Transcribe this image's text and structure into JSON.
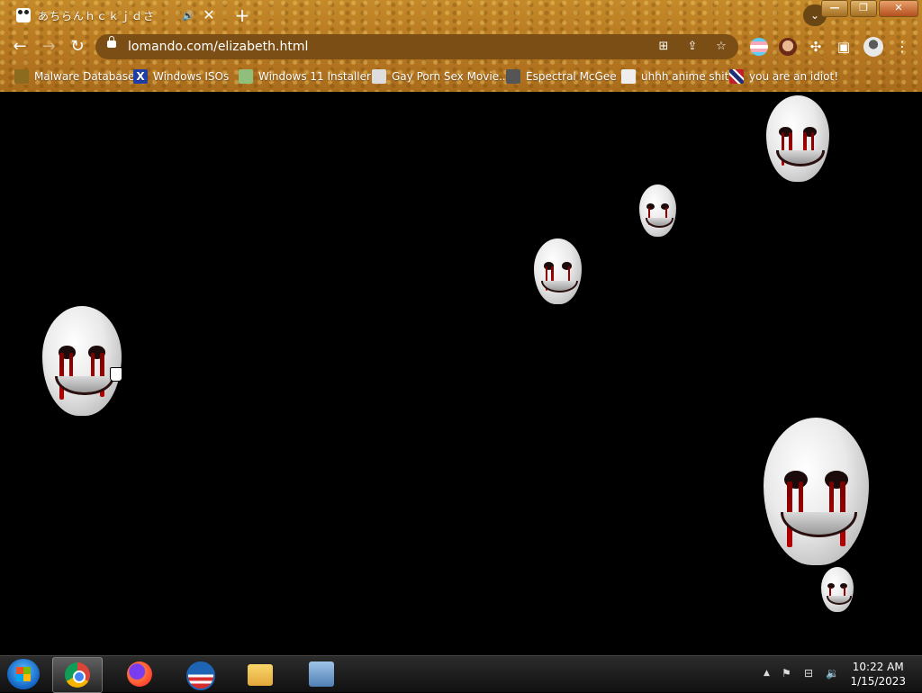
{
  "tab": {
    "title": "あちらんｈｃｋｊｄさ",
    "audio_icon": "speaker-icon",
    "close_label": "✕"
  },
  "window_controls": {
    "minimize": "—",
    "restore": "❐",
    "close": "✕"
  },
  "toolbar": {
    "back": "←",
    "forward": "→",
    "reload": "↻",
    "url": "lomando.com/elizabeth.html"
  },
  "omnibox_icons": [
    "translate-icon",
    "share-icon",
    "bookmark-star-icon"
  ],
  "extensions": [
    "trans-flag-extension-icon",
    "face-extension-icon",
    "puzzle-extension-icon",
    "side-panel-icon",
    "profile-avatar-icon",
    "menu-kebab-icon"
  ],
  "bookmarks": [
    {
      "label": "Malware Database",
      "icon": "folder-icon",
      "color": "#8c6a1e"
    },
    {
      "label": "Windows ISOs",
      "icon": "x-icon",
      "color": "#1f3ea8"
    },
    {
      "label": "Windows 11 Installer",
      "icon": "installer-icon",
      "color": "#8fbf7a"
    },
    {
      "label": "Gay Porn Sex Movie...",
      "icon": "site-icon",
      "color": "#dddddd"
    },
    {
      "label": "Espectral McGee",
      "icon": "cat-icon",
      "color": "#555555"
    },
    {
      "label": "uhhh anime shit",
      "icon": "anime-icon",
      "color": "#eeeeee"
    },
    {
      "label": "you are an idiot!",
      "icon": "flag-icon",
      "color": "#c21e2b"
    }
  ],
  "page": {
    "background": "#000000",
    "content": "floating white masks with bleeding eyes"
  },
  "taskbar": {
    "start": "start-orb-icon",
    "apps": [
      "chrome-icon",
      "firefox-icon",
      "obama-icon",
      "file-explorer-icon",
      "installer-icon"
    ]
  },
  "tray": {
    "expand": "▲",
    "icons": [
      "action-center-flag-icon",
      "network-icon",
      "volume-icon"
    ]
  },
  "clock": {
    "time": "10:22 AM",
    "date": "1/15/2023"
  }
}
